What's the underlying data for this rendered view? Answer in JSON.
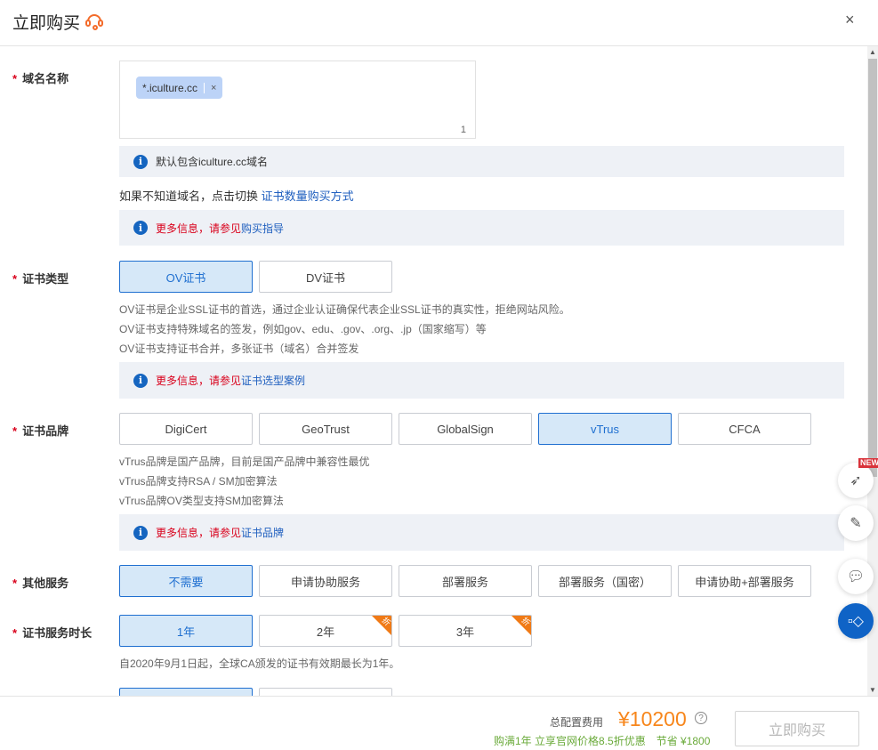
{
  "header": {
    "title": "立即购买",
    "close": "×"
  },
  "domain": {
    "label": "域名名称",
    "tag": "*.iculture.cc",
    "tag_remove": "×",
    "count": "1",
    "info": "默认包含iculture.cc域名",
    "switch_text": "如果不知道域名，点击切换 ",
    "switch_link": "证书数量购买方式",
    "more_prefix": "更多信息，",
    "more_mid": "请参见",
    "more_link": "购买指导"
  },
  "cert_type": {
    "label": "证书类型",
    "options": [
      "OV证书",
      "DV证书"
    ],
    "selected": 0,
    "desc": [
      "OV证书是企业SSL证书的首选，通过企业认证确保代表企业SSL证书的真实性，拒绝网站风险。",
      "OV证书支持特殊域名的签发，例如gov、edu、.gov、.org、.jp（国家缩写）等",
      "OV证书支持证书合并，多张证书（域名）合并签发"
    ],
    "more_prefix": "更多信息，",
    "more_mid": "请参见",
    "more_link": "证书选型案例"
  },
  "brand": {
    "label": "证书品牌",
    "options": [
      "DigiCert",
      "GeoTrust",
      "GlobalSign",
      "vTrus",
      "CFCA"
    ],
    "selected": 3,
    "desc": [
      "vTrus品牌是国产品牌，目前是国产品牌中兼容性最优",
      "vTrus品牌支持RSA / SM加密算法",
      "vTrus品牌OV类型支持SM加密算法"
    ],
    "more_prefix": "更多信息，",
    "more_mid": "请参见",
    "more_link": "证书品牌"
  },
  "service": {
    "label": "其他服务",
    "options": [
      "不需要",
      "申请协助服务",
      "部署服务",
      "部署服务（国密）",
      "申请协助+部署服务"
    ],
    "selected": 0
  },
  "duration": {
    "label": "证书服务时长",
    "options": [
      "1年",
      "2年",
      "3年"
    ],
    "selected": 0,
    "badge": "折",
    "note": "自2020年9月1日起，全球CA颁发的证书有效期最长为1年。"
  },
  "footer": {
    "total_label": "总配置费用",
    "price": "¥10200",
    "help": "?",
    "promo": "购满1年 立享官网价格8.5折优惠　节省 ¥1800",
    "buy": "立即购买"
  },
  "fabs": {
    "new_badge": "NEW"
  },
  "colors": {
    "accent": "#1f6fd0",
    "price": "#f7861b",
    "promo": "#6aaa3a",
    "required": "#d9001b"
  }
}
